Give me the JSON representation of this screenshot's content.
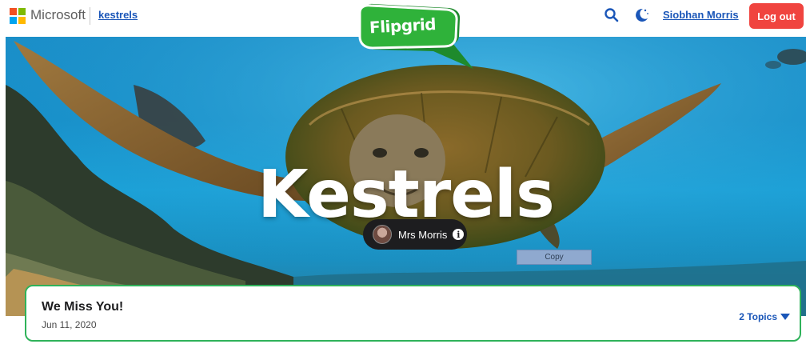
{
  "header": {
    "brand": "Microsoft",
    "group_link": "kestrels",
    "user_name": "Siobhan Morris",
    "logout_label": "Log out",
    "search_icon": "search-icon",
    "theme_icon": "moon-icon"
  },
  "logo": {
    "text": "Flipgrid",
    "color": "#2fb23a"
  },
  "hero": {
    "title": "Kestrels",
    "owner_name": "Mrs Morris",
    "info_icon": "i",
    "copy_tooltip": "Copy"
  },
  "topic": {
    "title": "We Miss You!",
    "date": "Jun 11, 2020",
    "topics_count_label": "2 Topics"
  },
  "colors": {
    "accent_link": "#1a56b8",
    "logout": "#f0443f",
    "card_border": "#2fb25a"
  }
}
